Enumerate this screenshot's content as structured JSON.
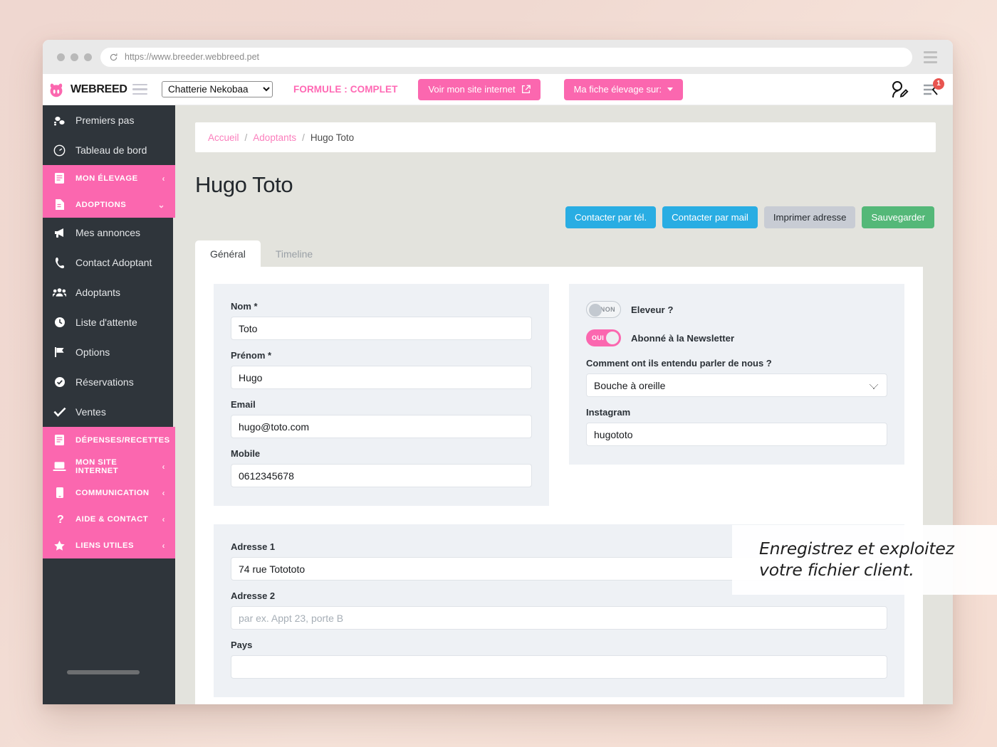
{
  "browser": {
    "url": "https://www.breeder.webbreed.pet",
    "reload_icon": "reload-icon",
    "menu_icon": "browser-menu-icon"
  },
  "header": {
    "brand": "WEBREED",
    "menu_icon": "hamburger-icon",
    "elevage_select": {
      "value": "Chatterie Nekobaa",
      "options": [
        "Chatterie Nekobaa"
      ]
    },
    "formule": "FORMULE : COMPLET",
    "site_button": "Voir mon site internet",
    "fiche_button": "Ma fiche élevage sur:",
    "user_icon": "user-edit-icon",
    "notifications_icon": "notifications-list-icon",
    "notifications_count": "1"
  },
  "sidebar": {
    "items": [
      {
        "label": "Premiers pas",
        "icon": "footsteps-icon",
        "type": "link"
      },
      {
        "label": "Tableau de bord",
        "icon": "gauge-icon",
        "type": "link"
      },
      {
        "label": "MON ÉLEVAGE",
        "icon": "book-icon",
        "type": "group",
        "chevron": "‹"
      },
      {
        "label": "ADOPTIONS",
        "icon": "file-icon",
        "type": "group",
        "chevron": "⌄"
      },
      {
        "label": "Mes annonces",
        "icon": "megaphone-icon",
        "type": "sub"
      },
      {
        "label": "Contact Adoptant",
        "icon": "phone-icon",
        "type": "sub"
      },
      {
        "label": "Adoptants",
        "icon": "users-icon",
        "type": "sub"
      },
      {
        "label": "Liste d'attente",
        "icon": "clock-icon",
        "type": "sub"
      },
      {
        "label": "Options",
        "icon": "flag-icon",
        "type": "sub"
      },
      {
        "label": "Réservations",
        "icon": "check-circle-icon",
        "type": "sub"
      },
      {
        "label": "Ventes",
        "icon": "check-icon",
        "type": "sub"
      },
      {
        "label": "DÉPENSES/RECETTES",
        "icon": "book-icon",
        "type": "group",
        "chevron": "‹"
      },
      {
        "label": "MON SITE INTERNET",
        "icon": "laptop-icon",
        "type": "group",
        "chevron": "‹"
      },
      {
        "label": "COMMUNICATION",
        "icon": "mobile-icon",
        "type": "group",
        "chevron": "‹"
      },
      {
        "label": "AIDE & CONTACT",
        "icon": "question-icon",
        "type": "group",
        "chevron": "‹"
      },
      {
        "label": "LIENS UTILES",
        "icon": "star-icon",
        "type": "group",
        "chevron": "‹"
      }
    ]
  },
  "breadcrumb": {
    "home": "Accueil",
    "section": "Adoptants",
    "current": "Hugo Toto",
    "separator": "/"
  },
  "page": {
    "title": "Hugo Toto"
  },
  "actions": {
    "phone": "Contacter par tél.",
    "mail": "Contacter par mail",
    "print": "Imprimer adresse",
    "save": "Sauvegarder"
  },
  "tabs": [
    {
      "label": "Général",
      "active": true
    },
    {
      "label": "Timeline",
      "active": false
    }
  ],
  "form": {
    "left": [
      {
        "label": "Nom *",
        "value": "Toto",
        "placeholder": ""
      },
      {
        "label": "Prénom *",
        "value": "Hugo",
        "placeholder": ""
      },
      {
        "label": "Email",
        "value": "hugo@toto.com",
        "placeholder": ""
      },
      {
        "label": "Mobile",
        "value": "0612345678",
        "placeholder": ""
      }
    ],
    "right": {
      "eleveur": {
        "label": "Eleveur ?",
        "state": "NON",
        "on": false
      },
      "newsletter": {
        "label": "Abonné à la Newsletter",
        "state": "OUI",
        "on": true
      },
      "source": {
        "label": "Comment ont ils entendu parler de nous ?",
        "value": "Bouche à oreille",
        "options": [
          "Bouche à oreille"
        ]
      },
      "instagram": {
        "label": "Instagram",
        "value": "hugototo",
        "placeholder": ""
      }
    },
    "address": [
      {
        "label": "Adresse 1",
        "value": "74 rue Totototo",
        "placeholder": ""
      },
      {
        "label": "Adresse 2",
        "value": "",
        "placeholder": "par ex. Appt 23, porte B"
      },
      {
        "label": "Pays",
        "value": "",
        "placeholder": ""
      }
    ]
  },
  "caption": {
    "line1": "Enregistrez et exploitez",
    "line2": "votre fichier client."
  },
  "colors": {
    "pink": "#fb67af",
    "sidebar": "#2f353b",
    "blue": "#29ade3",
    "green": "#54b878",
    "grey": "#c8ccd4",
    "badge_red": "#e8544f",
    "panel": "#eef1f5",
    "page_bg": "#e3e3dd"
  }
}
